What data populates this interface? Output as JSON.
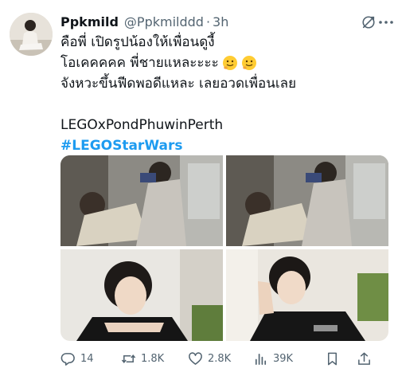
{
  "tweet": {
    "display_name": "Ppkmild",
    "handle": "@Ppkmilddd",
    "separator": "·",
    "time": "3h",
    "lines": [
      "คือพี่ เปิดรูปน้องให้เพื่อนดูงี้",
      "โอเคคคคค พี่ชายแหละะะะ",
      "จังหวะขึ้นฟีดพอดีแหละ เลยอวดเพื่อนเลย"
    ],
    "tag_line": "LEGOxPondPhuwinPerth",
    "hashtag": "#LEGOStarWars",
    "emoji_icons": [
      "slightly-smiling-face-icon",
      "slightly-smiling-face-icon"
    ]
  },
  "stats": {
    "replies": "14",
    "reposts": "1.8K",
    "likes": "2.8K",
    "views": "39K"
  },
  "colors": {
    "accent": "#1d9bf0",
    "text": "#0f1419",
    "secondary": "#536471"
  }
}
